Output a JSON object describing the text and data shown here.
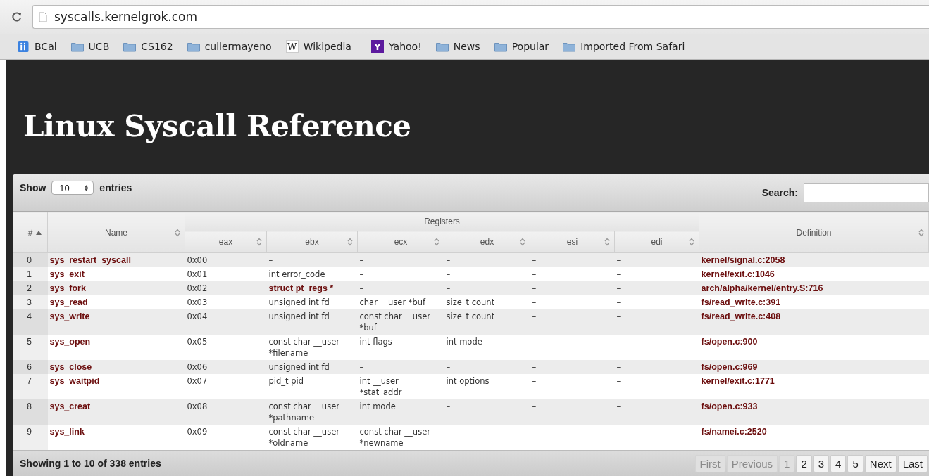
{
  "browser": {
    "url": "syscalls.kernelgrok.com",
    "bookmarks": [
      {
        "label": "BCal",
        "kind": "app"
      },
      {
        "label": "UCB",
        "kind": "folder"
      },
      {
        "label": "CS162",
        "kind": "folder"
      },
      {
        "label": "cullermayeno",
        "kind": "folder"
      },
      {
        "label": "Wikipedia",
        "kind": "letter",
        "glyph": "W",
        "color": "#ffffff"
      },
      {
        "label": "Yahoo!",
        "kind": "letter",
        "glyph": "Y",
        "color": "#5c1a9e"
      },
      {
        "label": "News",
        "kind": "folder"
      },
      {
        "label": "Popular",
        "kind": "folder"
      },
      {
        "label": "Imported From Safari",
        "kind": "folder"
      }
    ]
  },
  "page_title": "Linux Syscall Reference",
  "length_control": {
    "show_label": "Show",
    "value": "10",
    "entries_label": "entries"
  },
  "search": {
    "label": "Search:"
  },
  "table": {
    "group_header": "Registers",
    "columns": [
      {
        "label": "#",
        "sorted": true
      },
      {
        "label": "Name",
        "sorted": false
      },
      {
        "label": "eax",
        "sorted": false
      },
      {
        "label": "ebx",
        "sorted": false
      },
      {
        "label": "ecx",
        "sorted": false
      },
      {
        "label": "edx",
        "sorted": false
      },
      {
        "label": "esi",
        "sorted": false
      },
      {
        "label": "edi",
        "sorted": false
      },
      {
        "label": "Definition",
        "sorted": false
      }
    ],
    "rows": [
      {
        "num": "0",
        "name": "sys_restart_syscall",
        "eax": "0x00",
        "ebx": "–",
        "ebx_link": false,
        "ecx": "–",
        "edx": "–",
        "esi": "–",
        "edi": "–",
        "definition": "kernel/signal.c:2058"
      },
      {
        "num": "1",
        "name": "sys_exit",
        "eax": "0x01",
        "ebx": "int error_code",
        "ebx_link": false,
        "ecx": "–",
        "edx": "–",
        "esi": "–",
        "edi": "–",
        "definition": "kernel/exit.c:1046"
      },
      {
        "num": "2",
        "name": "sys_fork",
        "eax": "0x02",
        "ebx": "struct pt_regs *",
        "ebx_link": true,
        "ecx": "–",
        "edx": "–",
        "esi": "–",
        "edi": "–",
        "definition": "arch/alpha/kernel/entry.S:716"
      },
      {
        "num": "3",
        "name": "sys_read",
        "eax": "0x03",
        "ebx": "unsigned int fd",
        "ebx_link": false,
        "ecx": "char __user *buf",
        "edx": "size_t count",
        "esi": "–",
        "edi": "–",
        "definition": "fs/read_write.c:391"
      },
      {
        "num": "4",
        "name": "sys_write",
        "eax": "0x04",
        "ebx": "unsigned int fd",
        "ebx_link": false,
        "ecx": "const char __user *buf",
        "edx": "size_t count",
        "esi": "–",
        "edi": "–",
        "definition": "fs/read_write.c:408"
      },
      {
        "num": "5",
        "name": "sys_open",
        "eax": "0x05",
        "ebx": "const char __user *filename",
        "ebx_link": false,
        "ecx": "int flags",
        "edx": "int mode",
        "esi": "–",
        "edi": "–",
        "definition": "fs/open.c:900"
      },
      {
        "num": "6",
        "name": "sys_close",
        "eax": "0x06",
        "ebx": "unsigned int fd",
        "ebx_link": false,
        "ecx": "–",
        "edx": "–",
        "esi": "–",
        "edi": "–",
        "definition": "fs/open.c:969"
      },
      {
        "num": "7",
        "name": "sys_waitpid",
        "eax": "0x07",
        "ebx": "pid_t pid",
        "ebx_link": false,
        "ecx": "int __user *stat_addr",
        "edx": "int options",
        "esi": "–",
        "edi": "–",
        "definition": "kernel/exit.c:1771"
      },
      {
        "num": "8",
        "name": "sys_creat",
        "eax": "0x08",
        "ebx": "const char __user *pathname",
        "ebx_link": false,
        "ecx": "int mode",
        "edx": "–",
        "esi": "–",
        "edi": "–",
        "definition": "fs/open.c:933"
      },
      {
        "num": "9",
        "name": "sys_link",
        "eax": "0x09",
        "ebx": "const char __user *oldname",
        "ebx_link": false,
        "ecx": "const char __user *newname",
        "edx": "–",
        "esi": "–",
        "edi": "–",
        "definition": "fs/namei.c:2520"
      }
    ]
  },
  "info": "Showing 1 to 10 of 338 entries",
  "pagination": [
    {
      "label": "First",
      "disabled": true
    },
    {
      "label": "Previous",
      "disabled": true
    },
    {
      "label": "1",
      "disabled": true
    },
    {
      "label": "2",
      "disabled": false
    },
    {
      "label": "3",
      "disabled": false
    },
    {
      "label": "4",
      "disabled": false
    },
    {
      "label": "5",
      "disabled": false
    },
    {
      "label": "Next",
      "disabled": false
    },
    {
      "label": "Last",
      "disabled": false
    }
  ]
}
